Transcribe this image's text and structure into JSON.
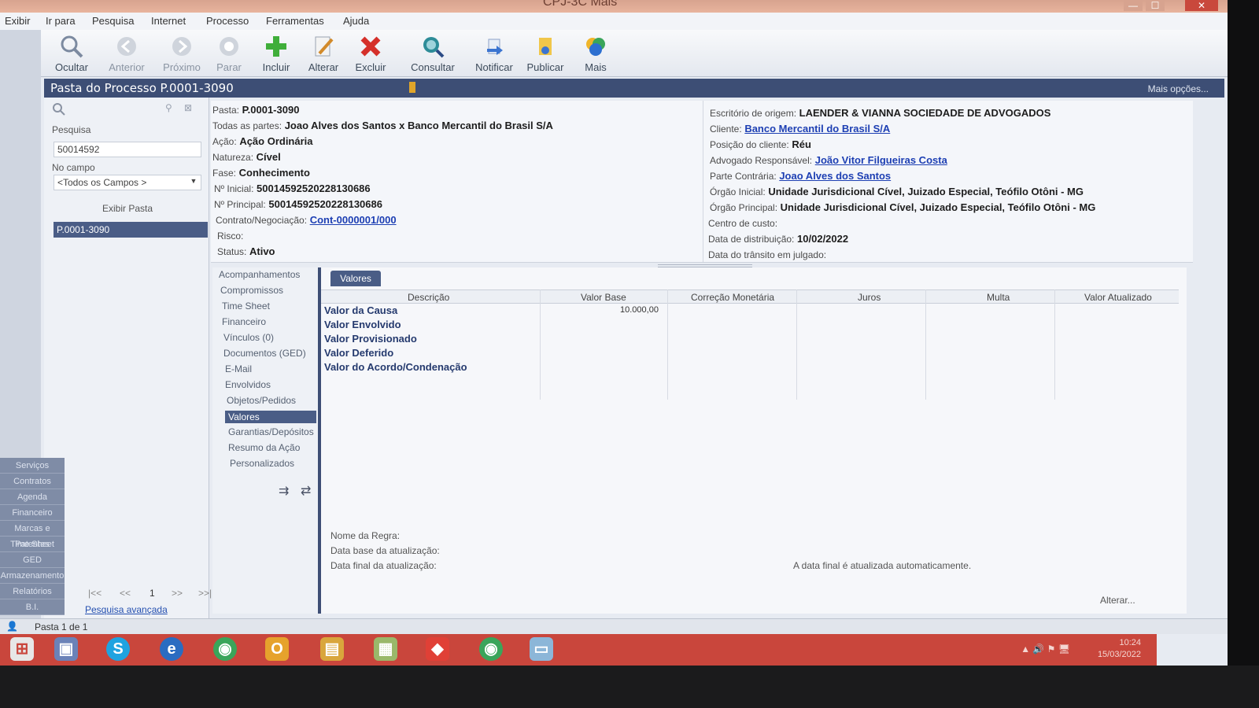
{
  "window": {
    "title": "CPJ-3C Mais",
    "close_label": "✕",
    "min_label": "—",
    "max_label": "☐"
  },
  "menu": [
    "Exibir",
    "Ir para",
    "Pesquisa",
    "Internet",
    "Processo",
    "Ferramentas",
    "Ajuda"
  ],
  "toolbar": [
    {
      "label": "Ocultar",
      "icon": "magnifier-icon",
      "enabled": true
    },
    {
      "label": "Anterior",
      "icon": "back-icon",
      "enabled": false
    },
    {
      "label": "Próximo",
      "icon": "forward-icon",
      "enabled": false
    },
    {
      "label": "Parar",
      "icon": "stop-icon",
      "enabled": false
    },
    {
      "label": "Incluir",
      "icon": "plus-icon",
      "enabled": true
    },
    {
      "label": "Alterar",
      "icon": "edit-icon",
      "enabled": true
    },
    {
      "label": "Excluir",
      "icon": "delete-icon",
      "enabled": true
    },
    {
      "label": "Consultar",
      "icon": "search-globe-icon",
      "enabled": true
    },
    {
      "label": "Notificar",
      "icon": "notify-icon",
      "enabled": true
    },
    {
      "label": "Publicar",
      "icon": "publish-icon",
      "enabled": true
    },
    {
      "label": "Mais",
      "icon": "more-icon",
      "enabled": true
    }
  ],
  "header": {
    "title": "Pasta do Processo P.0001-3090",
    "more_options": "Mais opções..."
  },
  "search_panel": {
    "search_label": "Pesquisa",
    "search_value": "50014592",
    "field_label": "No campo",
    "field_value": "<Todos os Campos >",
    "show_button": "Exibir Pasta",
    "result": "P.0001-3090",
    "pager": {
      "first": "|<<",
      "prev": "<<",
      "page": "1",
      "next": ">>",
      "last": ">>|"
    },
    "advanced_link": "Pesquisa avançada"
  },
  "side_nav": [
    "Serviços",
    "Contratos",
    "Agenda",
    "Financeiro",
    "Marcas e Patentes",
    "Time Sheet",
    "GED",
    "Armazenamento",
    "Relatórios",
    "B.I."
  ],
  "left_info": {
    "pasta": {
      "k": "Pasta:",
      "v": "P.0001-3090"
    },
    "partes": {
      "k": "Todas as partes:",
      "v": "Joao Alves dos Santos x Banco Mercantil do Brasil S/A"
    },
    "acao": {
      "k": "Ação:",
      "v": "Ação Ordinária"
    },
    "natureza": {
      "k": "Natureza:",
      "v": "Cível"
    },
    "fase": {
      "k": "Fase:",
      "v": "Conhecimento"
    },
    "n_inicial": {
      "k": "Nº Inicial:",
      "v": "50014592520228130686"
    },
    "n_principal": {
      "k": "Nº Principal:",
      "v": "50014592520228130686"
    },
    "contrato": {
      "k": "Contrato/Negociação:",
      "v": "Cont-0000001/000"
    },
    "risco": {
      "k": "Risco:",
      "v": ""
    },
    "status": {
      "k": "Status:",
      "v": "Ativo"
    }
  },
  "right_info": {
    "escritorio": {
      "k": "Escritório de origem:",
      "v": "LAENDER & VIANNA SOCIEDADE DE ADVOGADOS"
    },
    "cliente": {
      "k": "Cliente:",
      "v": "Banco Mercantil do Brasil S/A"
    },
    "posicao": {
      "k": "Posição do cliente:",
      "v": "Réu"
    },
    "advogado": {
      "k": "Advogado Responsável:",
      "v": "João Vitor Filgueiras Costa"
    },
    "parte_contraria": {
      "k": "Parte Contrária:",
      "v": "Joao Alves dos Santos"
    },
    "orgao_inicial": {
      "k": "Órgão Inicial:",
      "v": "Unidade Jurisdicional Cível, Juizado Especial, Teófilo Otôni - MG"
    },
    "orgao_principal": {
      "k": "Órgão Principal:",
      "v": "Unidade Jurisdicional Cível, Juizado Especial, Teófilo Otôni - MG"
    },
    "centro_custo": {
      "k": "Centro de custo:",
      "v": ""
    },
    "distribuicao": {
      "k": "Data de distribuição:",
      "v": "10/02/2022"
    },
    "transito": {
      "k": "Data do trânsito em julgado:",
      "v": ""
    }
  },
  "tabs": [
    "Acompanhamentos",
    "Compromissos",
    "Time Sheet",
    "Financeiro",
    "Vínculos (0)",
    "Documentos (GED)",
    "E-Mail",
    "Envolvidos",
    "Objetos/Pedidos",
    "Valores",
    "Garantias/Depósitos",
    "Resumo da Ação",
    "Personalizados"
  ],
  "valores": {
    "tab_label": "Valores",
    "columns": [
      "Descrição",
      "Valor Base",
      "Correção Monetária",
      "Juros",
      "Multa",
      "Valor Atualizado"
    ],
    "rows": [
      {
        "desc": "Valor da Causa",
        "base": "10.000,00"
      },
      {
        "desc": "Valor Envolvido",
        "base": ""
      },
      {
        "desc": "Valor Provisionado",
        "base": ""
      },
      {
        "desc": "Valor Deferido",
        "base": ""
      },
      {
        "desc": "Valor do Acordo/Condenação",
        "base": ""
      }
    ],
    "rule_label": "Nome da Regra:",
    "base_date_label": "Data base da atualização:",
    "final_date_label": "Data final da atualização:",
    "auto_note": "A data final é atualizada automaticamente.",
    "alter_button": "Alterar..."
  },
  "status": {
    "text": "Pasta 1 de 1"
  },
  "taskbar": {
    "apps": [
      "windows-start-icon",
      "explorer-icon",
      "skype-icon",
      "ie-icon",
      "chrome-icon",
      "outlook-icon",
      "folder-icon",
      "files-icon",
      "anydesk-icon",
      "chrome-icon",
      "notepad-icon"
    ],
    "time": "10:24",
    "date": "15/03/2022"
  }
}
